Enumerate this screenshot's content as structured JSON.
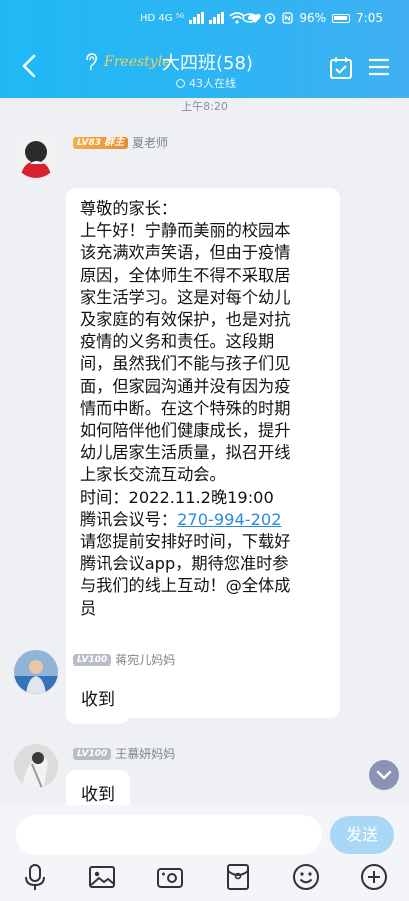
{
  "status_bar": {
    "network_left": "HD 4G ⁵ᴳ",
    "battery_percent": "96%",
    "time": "7:05"
  },
  "header": {
    "logo_text": "Freestyle",
    "title": "大四班(58)",
    "online_count": "43人在线"
  },
  "chat": {
    "timestamp": "上午8:20",
    "messages": [
      {
        "level": "LV83",
        "role": "群主",
        "sender": "夏老师",
        "lines": [
          "尊敬的家长：",
          "上午好！宁静而美丽的校园本",
          "该充满欢声笑语，但由于疫情",
          "原因，全体师生不得不采取居",
          "家生活学习。这是对每个幼儿",
          "及家庭的有效保护，也是对抗",
          "疫情的义务和责任。这段期",
          "间，虽然我们不能与孩子们见",
          "面，但家园沟通并没有因为疫",
          "情而中断。在这个特殊的时期",
          "如何陪伴他们健康成长，提升",
          "幼儿居家生活质量，拟召开线",
          "上家长交流互动会。",
          "时间：2022.11.2晚19:00",
          "腾讯会议号：",
          "请您提前安排好时间，下载好",
          "腾讯会议app，期待您准时参",
          "与我们的线上互动！@全体成",
          "员"
        ],
        "meeting_id": "270-994-202"
      },
      {
        "level": "LV100",
        "sender": "蒋宛儿妈妈",
        "text": "收到"
      },
      {
        "level": "LV100",
        "sender": "王慕妍妈妈",
        "text": "收到"
      }
    ]
  },
  "input": {
    "placeholder": "",
    "send_label": "发送"
  },
  "toolbar": {
    "icons": [
      "microphone-icon",
      "image-icon",
      "camera-icon",
      "red-packet-icon",
      "emoji-icon",
      "plus-icon"
    ]
  },
  "colors": {
    "header": "#2fb4f3",
    "link": "#2a8be0",
    "send_button": "#a9d7f6"
  }
}
